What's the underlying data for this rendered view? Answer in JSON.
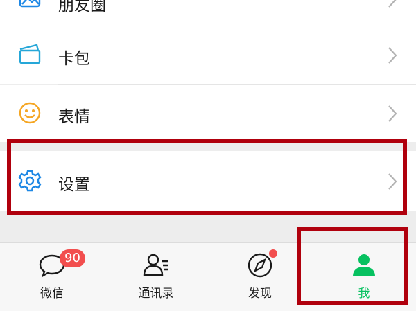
{
  "menu": {
    "items": [
      {
        "label": "朋友圈",
        "icon": "photo-album-icon"
      },
      {
        "label": "卡包",
        "icon": "card-pack-icon"
      },
      {
        "label": "表情",
        "icon": "smiley-icon"
      },
      {
        "label": "设置",
        "icon": "gear-icon"
      }
    ]
  },
  "tabbar": {
    "tabs": [
      {
        "label": "微信",
        "icon": "chat-bubble-icon",
        "badge": "90"
      },
      {
        "label": "通讯录",
        "icon": "contacts-icon"
      },
      {
        "label": "发现",
        "icon": "compass-icon",
        "dot": true
      },
      {
        "label": "我",
        "icon": "person-icon",
        "active": true
      }
    ]
  },
  "colors": {
    "accent": "#07c160",
    "icon_blue": "#1e88e5",
    "icon_teal": "#26a7d8",
    "icon_orange": "#f5a623",
    "badge": "#f24e4e",
    "highlight": "#b0000d"
  }
}
